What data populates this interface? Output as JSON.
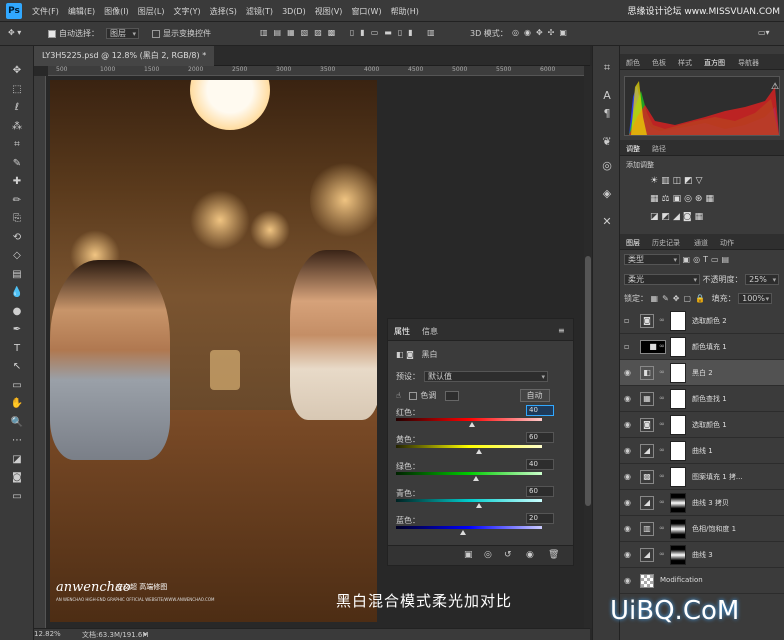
{
  "app": {
    "logo": "Ps",
    "watermark": "思缘设计论坛 www.MISSVUAN.COM"
  },
  "menu": [
    "文件(F)",
    "编辑(E)",
    "图像(I)",
    "图层(L)",
    "文字(Y)",
    "选择(S)",
    "滤镜(T)",
    "3D(D)",
    "视图(V)",
    "窗口(W)",
    "帮助(H)"
  ],
  "options": {
    "auto_select": "自动选择：",
    "auto_select_value": "图层",
    "show_transform": "显示变换控件",
    "mode_3d": "3D 模式："
  },
  "doc_tab": "LY3H5225.psd @ 12.8% (黑白 2, RGB/8) *",
  "ruler": [
    "500",
    "1000",
    "1500",
    "2000",
    "2500",
    "3000",
    "3500",
    "4000",
    "4500",
    "5000",
    "5500",
    "6000"
  ],
  "photo": {
    "logo": "anwenchao",
    "logo_cn": "安文超 高端修图",
    "logo_sub": "AN WENCHAO HIGH-END GRAPHIC OFFICIAL WEBSITE/WWW.ANWENCHAO.COM"
  },
  "caption": "黑白混合模式柔光加对比",
  "status": {
    "zoom": "12.82%",
    "doc": "文档:63.3M/191.6M"
  },
  "properties": {
    "tab1": "属性",
    "tab2": "信息",
    "type": "黑白",
    "preset_label": "预设：",
    "preset": "默认值",
    "tint": "色调",
    "auto": "自动",
    "sliders": [
      {
        "label": "红色：",
        "value": "40",
        "pos": 0.52
      },
      {
        "label": "黄色：",
        "value": "60",
        "pos": 0.57
      },
      {
        "label": "绿色：",
        "value": "40",
        "pos": 0.55
      },
      {
        "label": "青色：",
        "value": "60",
        "pos": 0.57
      },
      {
        "label": "蓝色：",
        "value": "20",
        "pos": 0.46
      }
    ]
  },
  "right": {
    "tabs1": [
      "颜色",
      "色板",
      "样式",
      "直方图",
      "导航器"
    ],
    "tabs2": [
      "调整",
      "路径"
    ],
    "add_adjust": "添加调整",
    "tabs3": [
      "图层",
      "历史记录",
      "通道",
      "动作"
    ],
    "kind": "类型",
    "blend": "柔光",
    "opacity_label": "不透明度：",
    "opacity": "25%",
    "lock_label": "锁定：",
    "fill_label": "填充：",
    "fill": "100%",
    "layers": [
      {
        "name": "选取颜色 2",
        "visible": false
      },
      {
        "name": "颜色填充 1",
        "visible": false
      },
      {
        "name": "黑白 2",
        "visible": true
      },
      {
        "name": "颜色查找 1",
        "visible": true
      },
      {
        "name": "选取颜色 1",
        "visible": true
      },
      {
        "name": "曲线 1",
        "visible": true
      },
      {
        "name": "图案填充 1 拷...",
        "visible": true
      },
      {
        "name": "曲线 3 拷贝",
        "visible": true
      },
      {
        "name": "色相/饱和度 1",
        "visible": true
      },
      {
        "name": "曲线 3",
        "visible": true
      },
      {
        "name": "Modification",
        "visible": true
      }
    ]
  },
  "bottom_watermark": "UiBQ.CoM",
  "colors": {
    "accent": "#31a8ff",
    "panel": "#3b3b3b"
  }
}
